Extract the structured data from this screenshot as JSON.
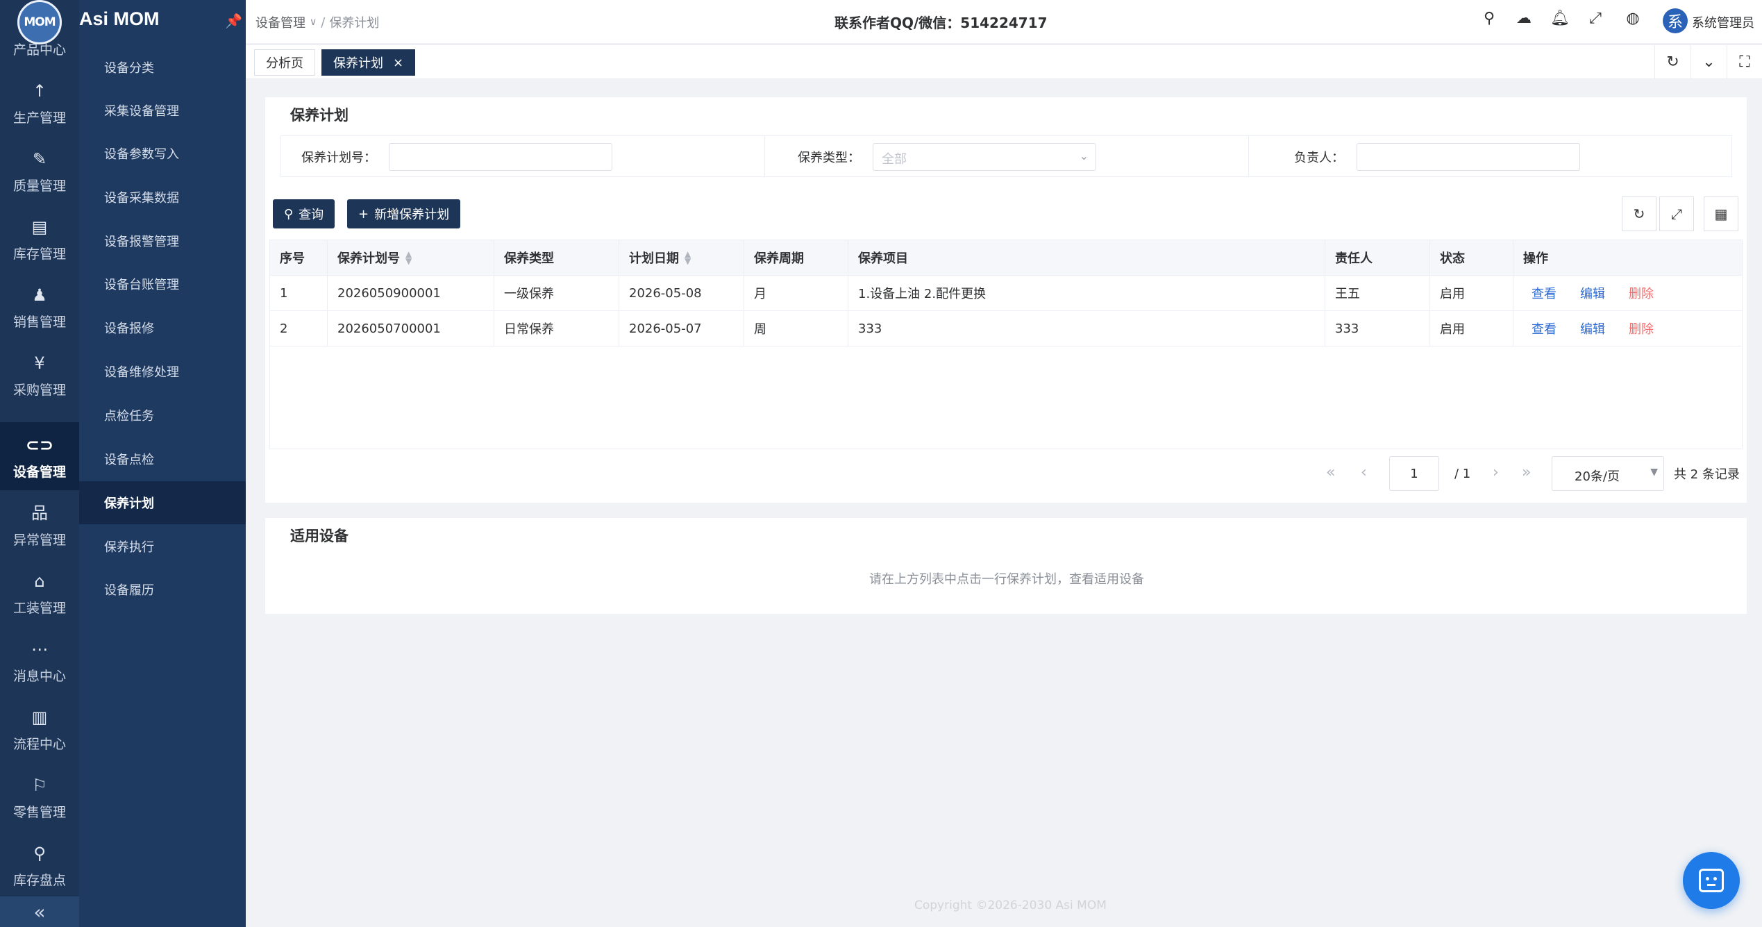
{
  "app": {
    "name": "Asi MOM",
    "logo_text": "MOM"
  },
  "rail": {
    "items": [
      {
        "label": "产品中心",
        "icon": "logo"
      },
      {
        "label": "生产管理",
        "icon": "arrow-up-icon",
        "glyph": "↑"
      },
      {
        "label": "质量管理",
        "icon": "wrench-icon",
        "glyph": "✎"
      },
      {
        "label": "库存管理",
        "icon": "document-icon",
        "glyph": "▤"
      },
      {
        "label": "销售管理",
        "icon": "bell-icon",
        "glyph": "♟"
      },
      {
        "label": "采购管理",
        "icon": "yen-icon",
        "glyph": "¥"
      },
      {
        "label": "设备管理",
        "icon": "link-icon",
        "glyph": "⊂⊃"
      },
      {
        "label": "异常管理",
        "icon": "hierarchy-icon",
        "glyph": "品"
      },
      {
        "label": "工装管理",
        "icon": "bank-icon",
        "glyph": "⌂"
      },
      {
        "label": "消息中心",
        "icon": "chat-icon",
        "glyph": "⋯"
      },
      {
        "label": "流程中心",
        "icon": "board-icon",
        "glyph": "▥"
      },
      {
        "label": "零售管理",
        "icon": "flag-icon",
        "glyph": "⚐"
      },
      {
        "label": "库存盘点",
        "icon": "magnifier-icon",
        "glyph": "⚲"
      }
    ],
    "active_index": 6,
    "collapse_glyph": "«"
  },
  "submenu": {
    "items": [
      "设备分类",
      "采集设备管理",
      "设备参数写入",
      "设备采集数据",
      "设备报警管理",
      "设备台账管理",
      "设备报修",
      "设备维修处理",
      "点检任务",
      "设备点检",
      "保养计划",
      "保养执行",
      "设备履历"
    ],
    "active_index": 10
  },
  "topbar": {
    "breadcrumb": {
      "parent": "设备管理",
      "current": "保养计划"
    },
    "contact": "联系作者QQ/微信：514224717",
    "user": {
      "avatar": "系",
      "name": "系统管理员"
    }
  },
  "tabs": [
    {
      "label": "分析页",
      "active": false
    },
    {
      "label": "保养计划",
      "active": true,
      "close": "×"
    }
  ],
  "plan_card": {
    "title": "保养计划",
    "filters": {
      "plan_no": {
        "label": "保养计划号：",
        "value": ""
      },
      "type": {
        "label": "保养类型：",
        "value": "全部"
      },
      "owner": {
        "label": "负责人：",
        "value": ""
      }
    },
    "buttons": {
      "query": "查询",
      "add": "新增保养计划"
    },
    "table": {
      "columns": [
        "序号",
        "保养计划号",
        "保养类型",
        "计划日期",
        "保养周期",
        "保养项目",
        "责任人",
        "状态",
        "操作"
      ],
      "rows": [
        {
          "idx": "1",
          "plan_no": "2026050900001",
          "type": "一级保养",
          "date": "2026-05-08",
          "cycle": "月",
          "items": "1.设备上油 2.配件更换",
          "owner": "王五",
          "status": "启用"
        },
        {
          "idx": "2",
          "plan_no": "2026050700001",
          "type": "日常保养",
          "date": "2026-05-07",
          "cycle": "周",
          "items": "333",
          "owner": "333",
          "status": "启用"
        }
      ],
      "actions": {
        "view": "查看",
        "edit": "编辑",
        "delete": "删除"
      }
    },
    "pagination": {
      "page": "1",
      "pages": "/ 1",
      "page_size": "20条/页",
      "total": "共 2 条记录"
    }
  },
  "equipment_card": {
    "title": "适用设备",
    "hint": "请在上方列表中点击一行保养计划，查看适用设备"
  },
  "footer": "Copyright ©2026-2030 Asi MOM"
}
